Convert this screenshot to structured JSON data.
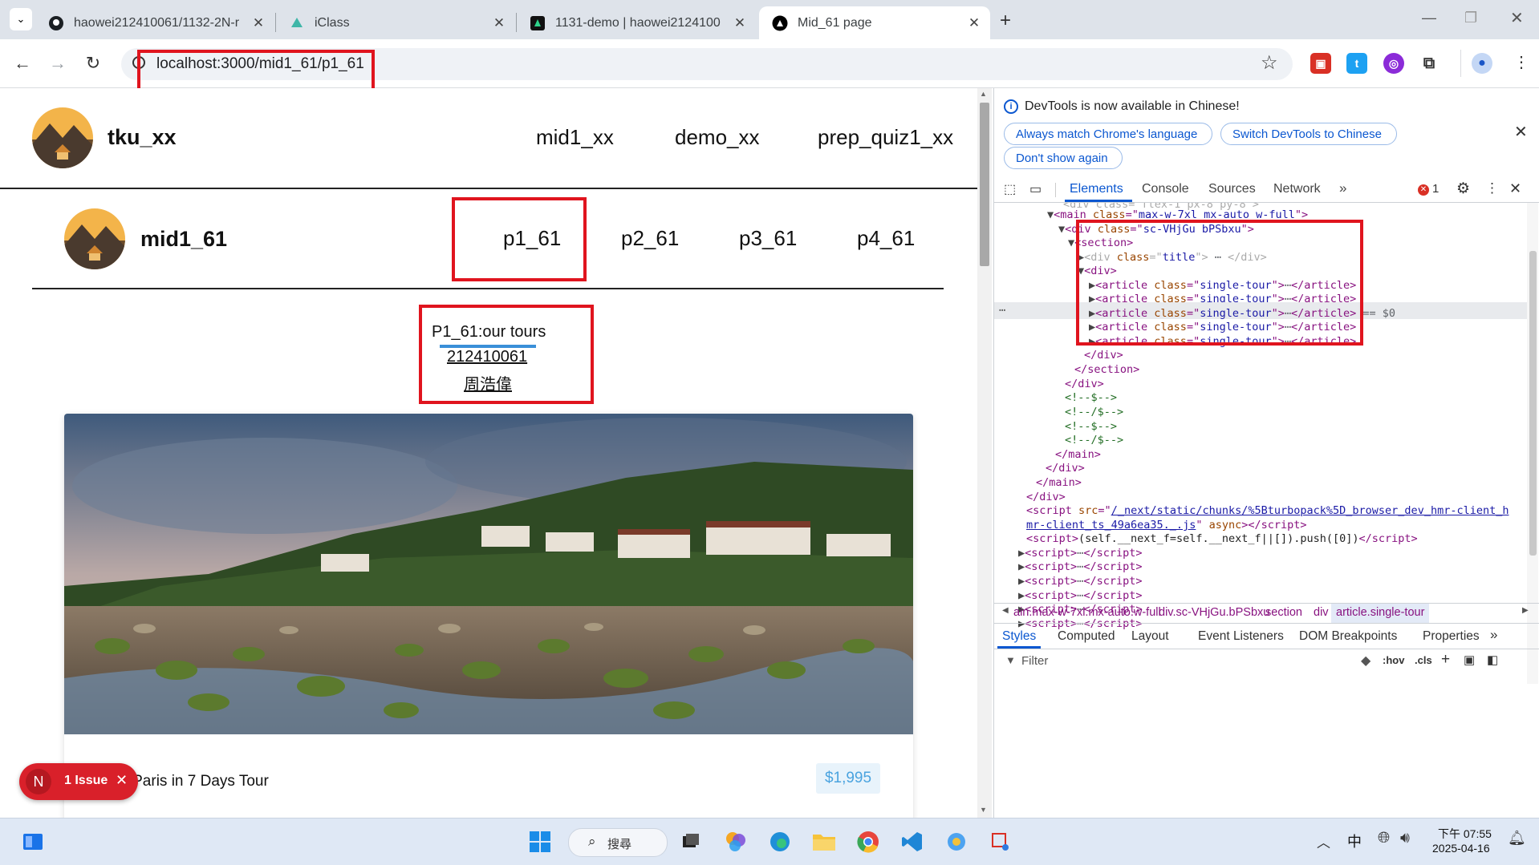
{
  "browser": {
    "tabs": [
      {
        "label": "haowei212410061/1132-2N-r",
        "icon": "github-icon"
      },
      {
        "label": "iClass",
        "icon": "iclass-icon"
      },
      {
        "label": "1131-demo | haowei2124100",
        "icon": "vercel-icon"
      },
      {
        "label": "Mid_61 page",
        "icon": "nextjs-icon"
      }
    ],
    "url": "localhost:3000/mid1_61/p1_61"
  },
  "page": {
    "site_title": "tku_xx",
    "main_nav": [
      "mid1_xx",
      "demo_xx",
      "prep_quiz1_xx"
    ],
    "sub_title": "mid1_61",
    "sub_nav": [
      "p1_61",
      "p2_61",
      "p3_61",
      "p4_61"
    ],
    "heading": "P1_61:our tours",
    "student_id": "212410061",
    "student_name": "周浩偉",
    "tour_name": "of Paris in 7 Days Tour",
    "tour_price": "$1,995",
    "issue_badge": {
      "letter": "N",
      "label": "1 Issue"
    }
  },
  "devtools": {
    "banner": "DevTools is now available in Chinese!",
    "btn_match": "Always match Chrome's language",
    "btn_switch": "Switch DevTools to Chinese",
    "btn_dont_show": "Don't show again",
    "tabs": [
      "Elements",
      "Console",
      "Sources",
      "Network"
    ],
    "error_count": "1",
    "breadcrumb": [
      "ain.max-w-7xl.mx-auto.w-full",
      "div.sc-VHjGu.bPSbxu",
      "section",
      "div",
      "article.single-tour"
    ],
    "style_tabs": [
      "Styles",
      "Computed",
      "Layout",
      "Event Listeners",
      "DOM Breakpoints",
      "Properties"
    ],
    "filter_placeholder": "Filter",
    "hov": ":hov",
    "cls": ".cls",
    "dom_lines": {
      "main_class": "max-w-7xl mx-auto w-full",
      "div_class": "sc-VHjGu bPSbxu",
      "div_title_class": "title",
      "article_class": "single-tour",
      "eq_marker": "== $0",
      "comment_open": "<!--$-->",
      "comment_close": "<!--/$-->",
      "script_src_1": "/_next/static/chunks/%5Bturbopack%5D_browser_dev_hmr-client_h",
      "script_src_2": "mr-client_ts_49a6ea35._.js",
      "script_inline": "(self.__next_f=self.__next_f||[]).push([0])"
    }
  },
  "taskbar": {
    "search_label": "搜尋",
    "ime": "中",
    "time": "下午 07:55",
    "date": "2025-04-16"
  }
}
